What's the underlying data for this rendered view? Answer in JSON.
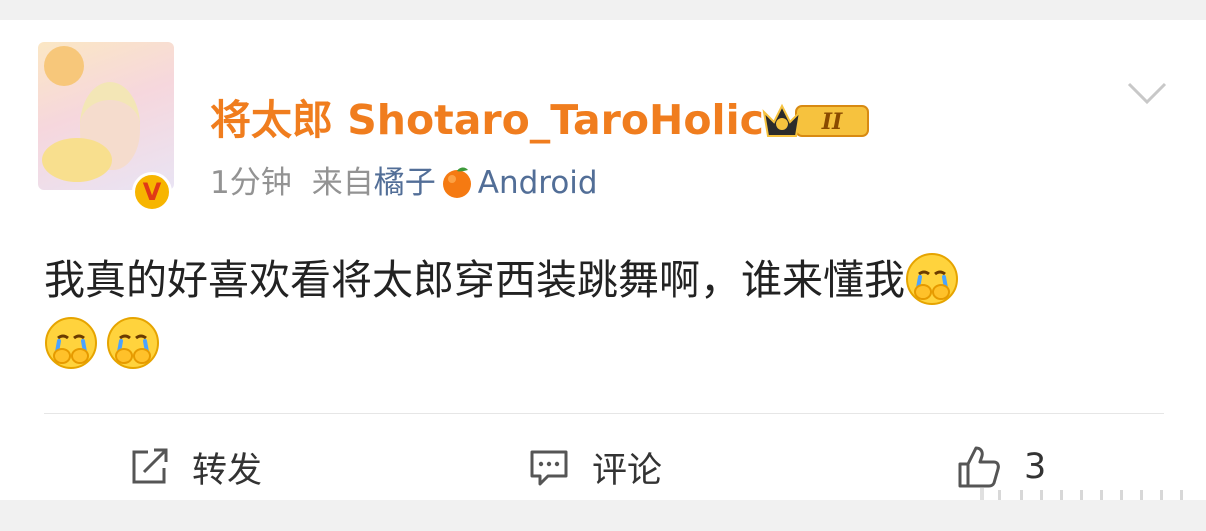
{
  "post": {
    "author": {
      "name": "将太郎 Shotaro_TaroHolic",
      "avatar_icon": "avatar-image",
      "verified_badge": "V",
      "level_badge": "II"
    },
    "meta": {
      "time": "1分钟",
      "source_prefix": "来自",
      "source_name": "橘子",
      "source_icon": "orange-icon",
      "source_platform": "Android"
    },
    "content": {
      "text": "我真的好喜欢看将太郎穿西装跳舞啊，谁来懂我",
      "emoji": "crying-covering-mouth-emoji",
      "emoji_count": 3
    },
    "actions": {
      "repost_label": "转发",
      "comment_label": "评论",
      "like_count": "3"
    }
  },
  "colors": {
    "username": "#f07d1e",
    "source_link": "#526e97",
    "meta_gray": "#939393",
    "text": "#222222"
  }
}
